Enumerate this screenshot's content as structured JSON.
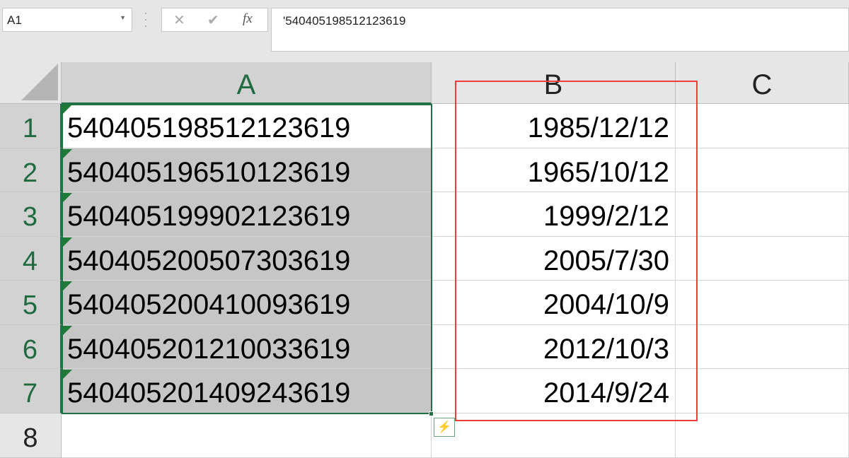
{
  "name_box": "A1",
  "formula": "'540405198512123619",
  "columns": [
    "A",
    "B",
    "C"
  ],
  "rows": [
    {
      "num": "1",
      "a": "540405198512123619",
      "b": "1985/12/12"
    },
    {
      "num": "2",
      "a": "540405196510123619",
      "b": "1965/10/12"
    },
    {
      "num": "3",
      "a": "540405199902123619",
      "b": "1999/2/12"
    },
    {
      "num": "4",
      "a": "540405200507303619",
      "b": "2005/7/30"
    },
    {
      "num": "5",
      "a": "540405200410093619",
      "b": "2004/10/9"
    },
    {
      "num": "6",
      "a": "540405201210033619",
      "b": "2012/10/3"
    },
    {
      "num": "7",
      "a": "540405201409243619",
      "b": "2014/9/24"
    },
    {
      "num": "8",
      "a": "",
      "b": ""
    }
  ],
  "colors": {
    "accent": "#217346",
    "highlight": "#f03c3c"
  }
}
